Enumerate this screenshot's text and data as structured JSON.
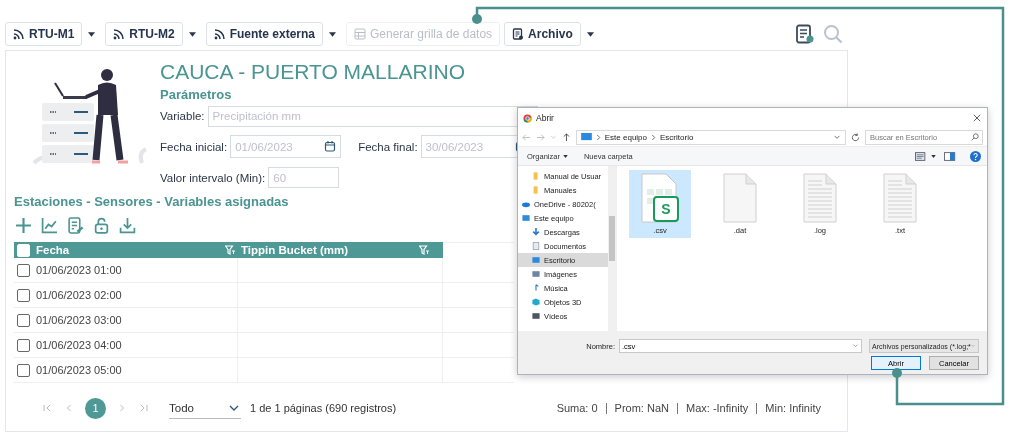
{
  "toolbar": {
    "buttons": [
      {
        "label": "RTU-M1",
        "kind": "feed",
        "disabled": false,
        "dropdown": true
      },
      {
        "label": "RTU-M2",
        "kind": "feed",
        "disabled": false,
        "dropdown": true
      },
      {
        "label": "Fuente externa",
        "kind": "feed",
        "disabled": false,
        "dropdown": true
      },
      {
        "label": "Generar grilla de datos",
        "kind": "grid",
        "disabled": true,
        "dropdown": false
      },
      {
        "label": "Archivo",
        "kind": "file",
        "disabled": false,
        "dropdown": true
      }
    ]
  },
  "station": {
    "title": "CAUCA - PUERTO MALLARINO",
    "section": "Parámetros"
  },
  "form": {
    "variable": {
      "label": "Variable:",
      "placeholder": "Precipitación mm"
    },
    "start_date": {
      "label": "Fecha inicial:",
      "placeholder": "01/06/2023"
    },
    "end_date": {
      "label": "Fecha final:",
      "placeholder": "30/06/2023"
    },
    "interval": {
      "label": "Valor intervalo (Min):",
      "placeholder": "60"
    }
  },
  "assignments": {
    "title": "Estaciones - Sensores - Variables asignadas"
  },
  "table": {
    "all_checked": false,
    "columns": [
      "Fecha",
      "Tippin Bucket (mm)"
    ],
    "rows": [
      {
        "date": "01/06/2023 01:00",
        "checked": false
      },
      {
        "date": "01/06/2023 02:00",
        "checked": false
      },
      {
        "date": "01/06/2023 03:00",
        "checked": false
      },
      {
        "date": "01/06/2023 04:00",
        "checked": false
      },
      {
        "date": "01/06/2023 05:00",
        "checked": false
      }
    ]
  },
  "pagination": {
    "pages": [
      {
        "label": "1",
        "selected": true
      }
    ],
    "page_size": "Todo",
    "summary": "1 de 1 páginas (690 registros)"
  },
  "stats": [
    "Suma: 0",
    "Prom: NaN",
    "Max: -Infinity",
    "Min: Infinity"
  ],
  "dialog": {
    "title": "Abrir",
    "path": [
      "Este equipo",
      "Escritorio"
    ],
    "search": {
      "placeholder": "Buscar en Escritorio"
    },
    "commands": [
      "Organizar",
      "Nueva carpeta"
    ],
    "nav": [
      {
        "label": "Manual de Usuar",
        "kind": "folder",
        "selected": false
      },
      {
        "label": "Manuales",
        "kind": "folder",
        "selected": false
      },
      {
        "label": "OneDrive - 80202(",
        "kind": "cloud",
        "selected": false
      },
      {
        "label": "Este equipo",
        "kind": "pc",
        "selected": false
      },
      {
        "label": "Descargas",
        "kind": "download",
        "selected": false
      },
      {
        "label": "Documentos",
        "kind": "docs",
        "selected": false
      },
      {
        "label": "Escritorio",
        "kind": "desktop",
        "selected": true
      },
      {
        "label": "Imágenes",
        "kind": "images",
        "selected": false
      },
      {
        "label": "Música",
        "kind": "music",
        "selected": false
      },
      {
        "label": "Objetos 3D",
        "kind": "cube",
        "selected": false
      },
      {
        "label": "Vídeos",
        "kind": "video",
        "selected": false
      }
    ],
    "files": [
      {
        "name": ".csv",
        "kind": "sheet",
        "badge": "S",
        "selected": true
      },
      {
        "name": ".dat",
        "kind": "blank",
        "selected": false
      },
      {
        "name": ".log",
        "kind": "text",
        "selected": false
      },
      {
        "name": ".txt",
        "kind": "text",
        "selected": false
      }
    ],
    "filename": {
      "label": "Nombre:",
      "value": ".csv"
    },
    "filter": "Archivos personalizados (*.log;*",
    "buttons": [
      {
        "label": "Abrir",
        "kind": "primary"
      },
      {
        "label": "Cancelar",
        "kind": "secondary"
      }
    ]
  }
}
